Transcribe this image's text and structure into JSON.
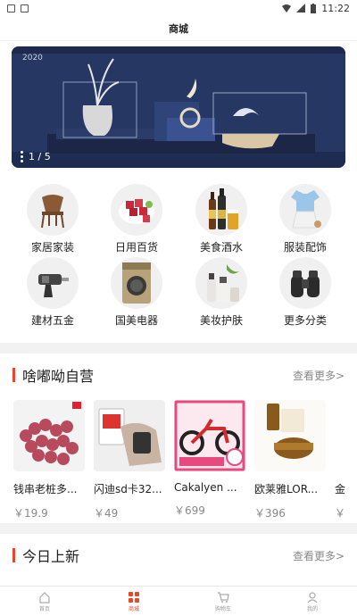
{
  "status_bar": {
    "time": "11:22"
  },
  "header": {
    "title": "商城"
  },
  "banner": {
    "counter": "1 / 5",
    "year_text": "2020"
  },
  "categories": [
    {
      "label": "家居家装",
      "icon": "chair-icon"
    },
    {
      "label": "日用百货",
      "icon": "meat-plate-icon"
    },
    {
      "label": "美食酒水",
      "icon": "beer-bottles-icon"
    },
    {
      "label": "服装配饰",
      "icon": "clothing-icon"
    },
    {
      "label": "建材五金",
      "icon": "drill-icon"
    },
    {
      "label": "国美电器",
      "icon": "washing-machine-icon"
    },
    {
      "label": "美妆护肤",
      "icon": "cosmetics-icon"
    },
    {
      "label": "更多分类",
      "icon": "binoculars-icon"
    }
  ],
  "section_self": {
    "title": "啥嘟呦自营",
    "more": "查看更多>",
    "products": [
      {
        "name": "钱串老桩多...",
        "price": "￥19.9"
      },
      {
        "name": "闪迪sd卡32...",
        "price": "￥49"
      },
      {
        "name": "Cakalyen ...",
        "price": "￥699"
      },
      {
        "name": "欧莱雅LOR...",
        "price": "￥396"
      },
      {
        "name": "金",
        "price": "￥"
      }
    ]
  },
  "section_new": {
    "title": "今日上新",
    "more": "查看更多>"
  },
  "tabbar": [
    {
      "label": "首页",
      "icon": "home-icon"
    },
    {
      "label": "商城",
      "icon": "shop-grid-icon"
    },
    {
      "label": "购物车",
      "icon": "cart-icon"
    },
    {
      "label": "我的",
      "icon": "user-icon"
    }
  ]
}
